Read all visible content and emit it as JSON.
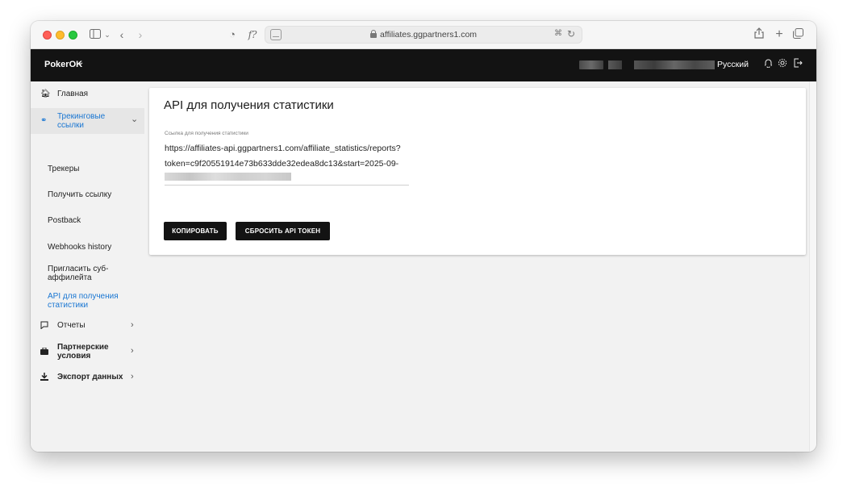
{
  "browser": {
    "url": "affiliates.ggpartners1.com"
  },
  "header": {
    "brand": "PokerOK",
    "language": "Русский"
  },
  "sidebar": {
    "items": [
      {
        "label": "Главная",
        "icon": "home-icon"
      },
      {
        "label": "Трекинговые\nссылки",
        "icon": "link-icon",
        "active": true
      },
      {
        "label": "Трекеры"
      },
      {
        "label": "Получить ссылку"
      },
      {
        "label": "Postback"
      },
      {
        "label": "Webhooks history"
      },
      {
        "label": "Пригласить суб-\nаффилейта"
      },
      {
        "label": "API для получения\nстатистики",
        "selected": true
      },
      {
        "label": "Отчеты",
        "icon": "report-icon"
      },
      {
        "label": "Партнерские\nусловия",
        "icon": "briefcase-icon"
      },
      {
        "label": "Экспорт данных",
        "icon": "download-icon"
      }
    ]
  },
  "main": {
    "title": "API для получения статистики",
    "field_label": "Ссылка для получения статистики",
    "field_line1": "https://affiliates-api.ggpartners1.com/affiliate_statistics/reports?",
    "field_line2": "token=c9f20551914e73b633dde32edea8dc13&start=2025-09-",
    "copy_button": "КОПИРОВАТЬ",
    "reset_button": "СБРОСИТЬ API ТОКЕН"
  },
  "colors": {
    "accent_blue": "#1976d2",
    "header_bg": "#131313",
    "button_bg": "#131313"
  }
}
